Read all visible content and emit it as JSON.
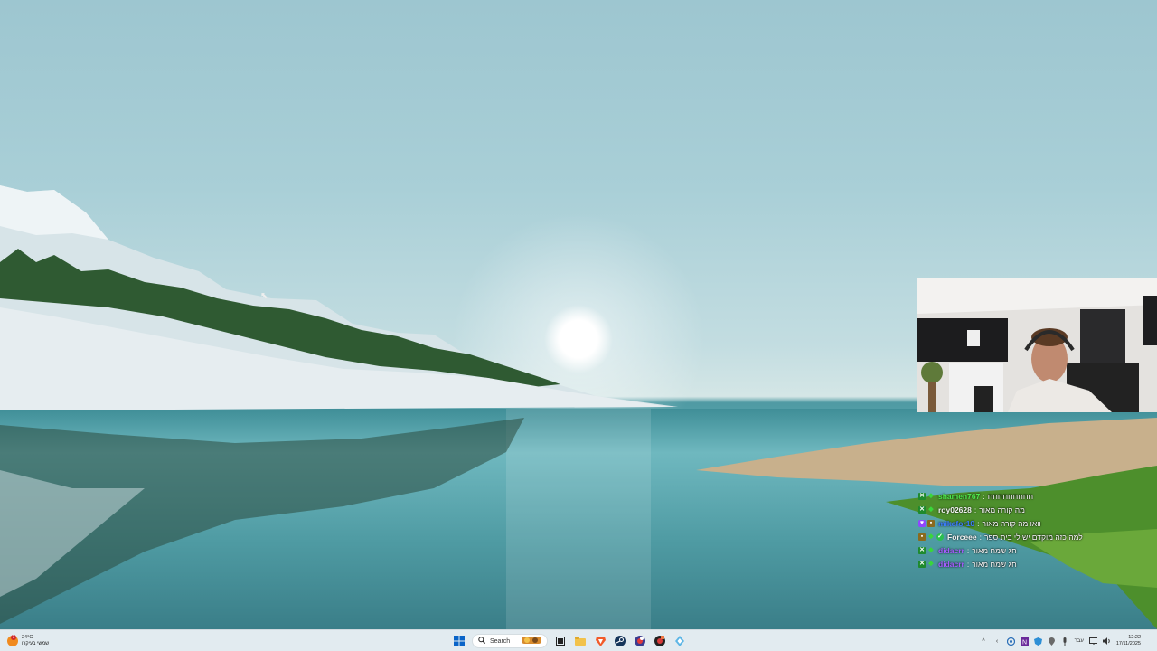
{
  "stream": {
    "chat": [
      {
        "badges": [
          "x",
          "diamond"
        ],
        "user": "shamen767",
        "user_color": "#4eea4e",
        "message": "חחחחחחחחח"
      },
      {
        "badges": [
          "x",
          "diamond"
        ],
        "user": "roy02628",
        "user_color": "#f2f2f2",
        "message": "מה קורה מאור"
      },
      {
        "badges": [
          "heart",
          "sq"
        ],
        "user": "mikefor10",
        "user_color": "#3a7bff",
        "message": "וואו מה קורה מאור"
      },
      {
        "badges": [
          "sq",
          "diamond",
          "check"
        ],
        "user": "Forceee",
        "user_color": "#f2f2f2",
        "message": "למה כזה מוקדם יש לי בית ספר"
      },
      {
        "badges": [
          "x",
          "diamond"
        ],
        "user": "didacrr",
        "user_color": "#a55cff",
        "message": "חג שמח מאור"
      },
      {
        "badges": [
          "x",
          "diamond"
        ],
        "user": "didacrr",
        "user_color": "#a55cff",
        "message": "חג שמח מאור"
      }
    ]
  },
  "taskbar": {
    "weather": {
      "temp": "24°C",
      "condition": "שמשי בעיקרו",
      "alert_count": "1"
    },
    "search_label": "Search",
    "apps": [
      "start-icon",
      "search",
      "widgets-icon",
      "task-view-icon",
      "file-explorer-icon",
      "brave-icon",
      "steam-icon",
      "obs-icon",
      "app-icon",
      "teams-icon"
    ],
    "tray": {
      "language": "עבר",
      "time": "12:22",
      "date": "17/11/2025"
    }
  },
  "colors": {
    "taskbar_bg": "#e2ebf0",
    "accent": "#0a64c8"
  }
}
